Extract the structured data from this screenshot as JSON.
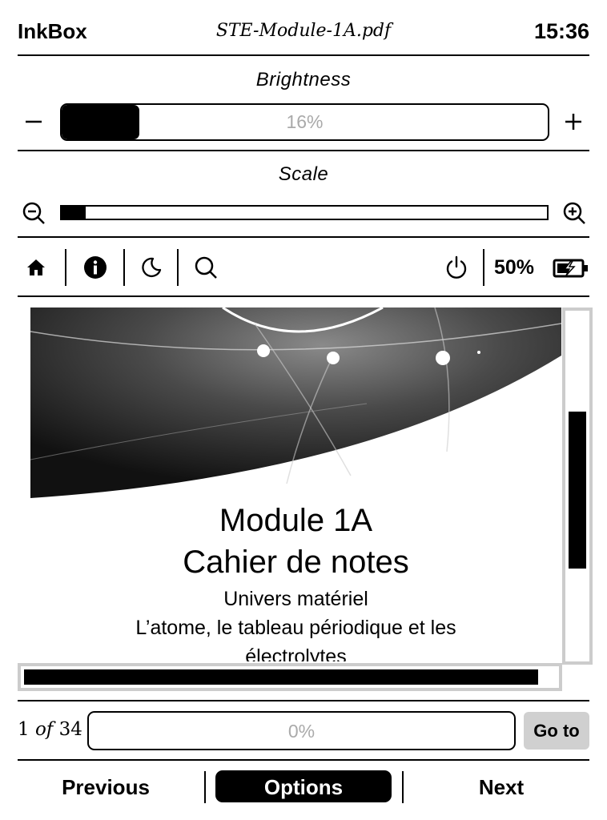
{
  "header": {
    "app_name": "InkBox",
    "file_name": "STE-Module-1A.pdf",
    "time": "15:36"
  },
  "brightness": {
    "label": "Brightness",
    "value_text": "16%",
    "level": 0.16
  },
  "scale": {
    "label": "Scale",
    "level": 0.05
  },
  "toolbar": {
    "icons": [
      "home-icon",
      "info-icon",
      "moon-icon",
      "search-icon",
      "power-icon",
      "battery-charging-icon"
    ],
    "battery_text": "50%"
  },
  "document": {
    "title_line1": "Module 1A",
    "title_line2": "Cahier de notes",
    "subtitle_line1": "Univers matériel",
    "subtitle_line2": "L’atome, le tableau périodique et les",
    "subtitle_line3": "électrolytes",
    "vertical_scroll_position": 0.52,
    "horizontal_scroll_position": 0.0
  },
  "navigation": {
    "page_current": "1",
    "page_of": "of",
    "page_total": "34",
    "progress_text": "0%",
    "goto_label": "Go to"
  },
  "bottom_bar": {
    "previous_label": "Previous",
    "options_label": "Options",
    "next_label": "Next"
  }
}
